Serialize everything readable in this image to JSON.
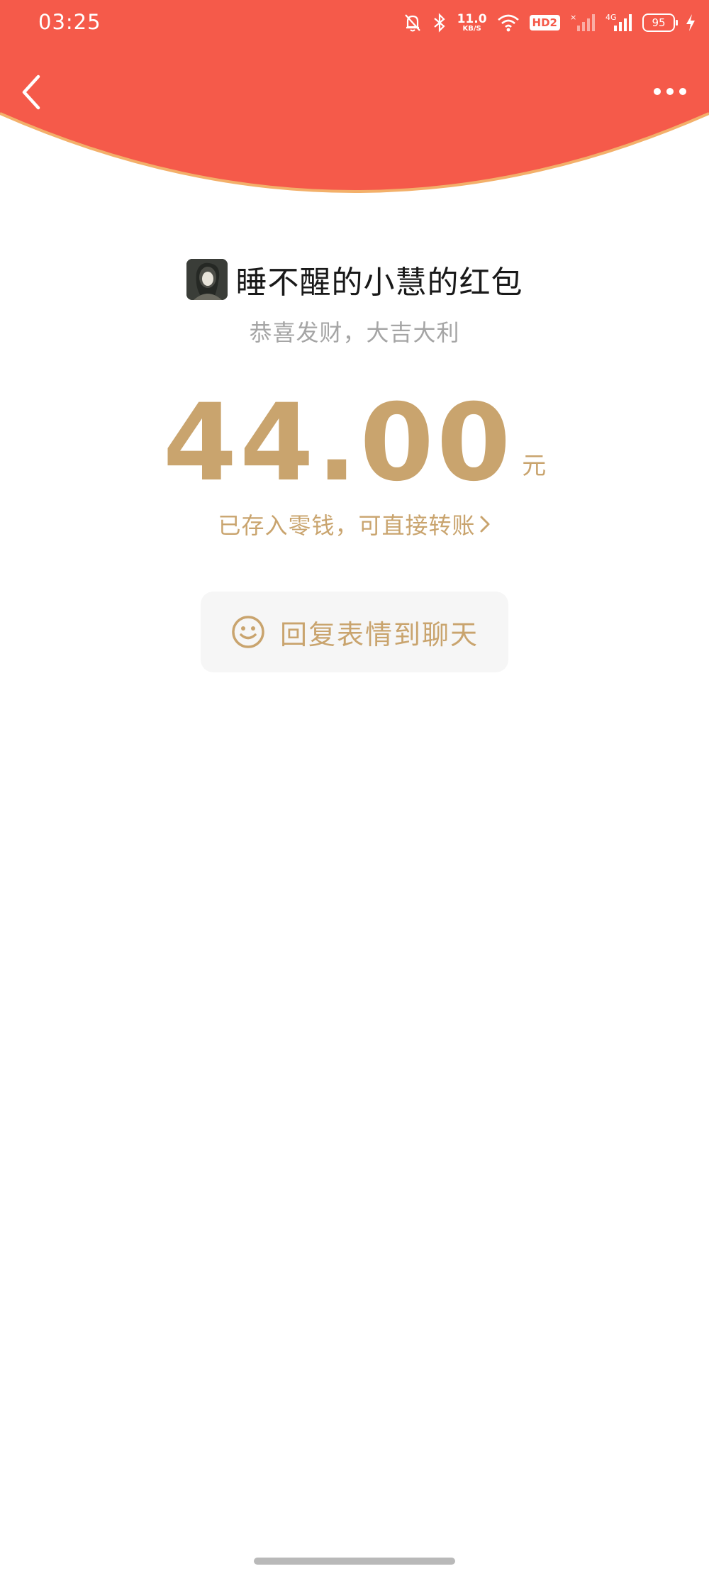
{
  "status_bar": {
    "time": "03:25",
    "net_speed_value": "11.0",
    "net_speed_unit": "KB/S",
    "hd_badge": "HD2",
    "sim1_label": "×",
    "sim2_label": "4G",
    "battery": "95",
    "icons": [
      "mute-bell-icon",
      "bluetooth-icon",
      "wifi-icon",
      "signal-icon",
      "charging-icon"
    ]
  },
  "colors": {
    "header_red": "#F55A4A",
    "gold_text": "#C9A46E",
    "grey_text": "#A5A5A5"
  },
  "envelope": {
    "sender_title": "睡不醒的小慧的红包",
    "blessing": "恭喜发财，大吉大利",
    "amount": "44.00",
    "currency_unit": "元",
    "saved_note": "已存入零钱，可直接转账",
    "reply_button_label": "回复表情到聊天"
  }
}
